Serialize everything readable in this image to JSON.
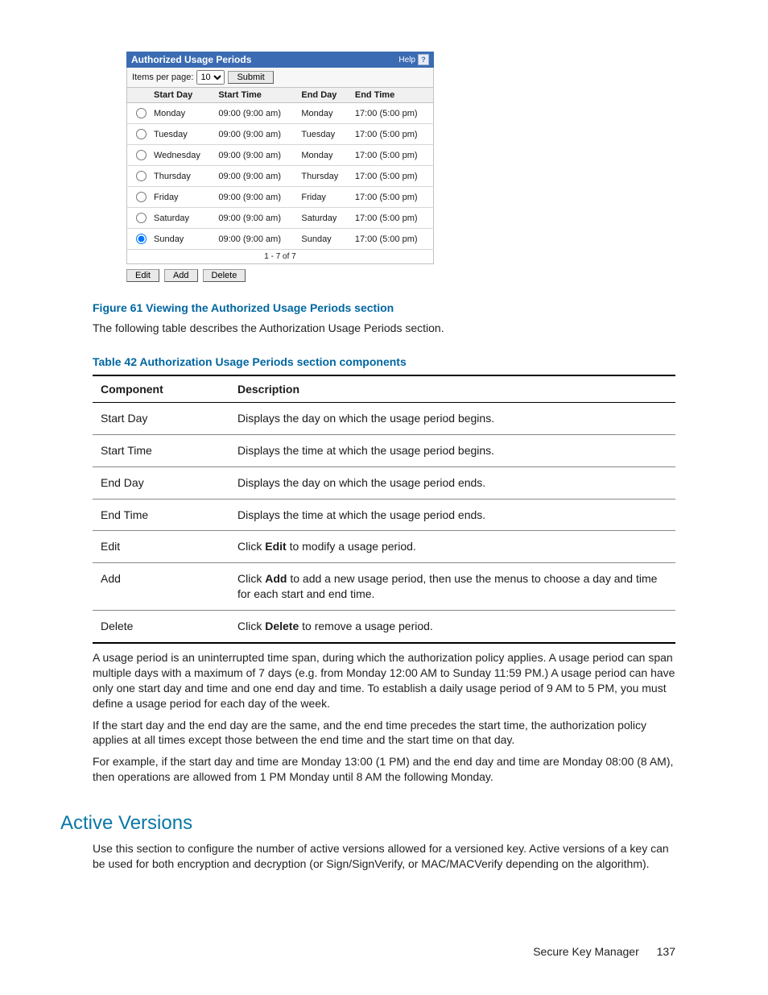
{
  "panel": {
    "title": "Authorized Usage Periods",
    "help_label": "Help",
    "items_per_page_label": "Items per page:",
    "items_per_page_value": "10",
    "submit_label": "Submit",
    "columns": {
      "start_day": "Start Day",
      "start_time": "Start Time",
      "end_day": "End Day",
      "end_time": "End Time"
    },
    "rows": [
      {
        "sel": false,
        "start_day": "Monday",
        "start_time": "09:00 (9:00 am)",
        "end_day": "Monday",
        "end_time": "17:00 (5:00 pm)"
      },
      {
        "sel": false,
        "start_day": "Tuesday",
        "start_time": "09:00 (9:00 am)",
        "end_day": "Tuesday",
        "end_time": "17:00 (5:00 pm)"
      },
      {
        "sel": false,
        "start_day": "Wednesday",
        "start_time": "09:00 (9:00 am)",
        "end_day": "Monday",
        "end_time": "17:00 (5:00 pm)"
      },
      {
        "sel": false,
        "start_day": "Thursday",
        "start_time": "09:00 (9:00 am)",
        "end_day": "Thursday",
        "end_time": "17:00 (5:00 pm)"
      },
      {
        "sel": false,
        "start_day": "Friday",
        "start_time": "09:00 (9:00 am)",
        "end_day": "Friday",
        "end_time": "17:00 (5:00 pm)"
      },
      {
        "sel": false,
        "start_day": "Saturday",
        "start_time": "09:00 (9:00 am)",
        "end_day": "Saturday",
        "end_time": "17:00 (5:00 pm)"
      },
      {
        "sel": true,
        "start_day": "Sunday",
        "start_time": "09:00 (9:00 am)",
        "end_day": "Sunday",
        "end_time": "17:00 (5:00 pm)"
      }
    ],
    "footer_range": "1 - 7 of 7",
    "actions": {
      "edit": "Edit",
      "add": "Add",
      "delete": "Delete"
    }
  },
  "figure_caption": "Figure 61 Viewing the Authorized Usage Periods section",
  "intro_para": "The following table describes the Authorization Usage Periods section.",
  "table_caption": "Table 42 Authorization Usage Periods section components",
  "comp_headers": {
    "component": "Component",
    "description": "Description"
  },
  "comp_rows": [
    {
      "component": "Start Day",
      "desc_pre": "Displays the day on which the usage period begins.",
      "bold": "",
      "desc_post": ""
    },
    {
      "component": "Start Time",
      "desc_pre": "Displays the time at which the usage period begins.",
      "bold": "",
      "desc_post": ""
    },
    {
      "component": "End Day",
      "desc_pre": "Displays the day on which the usage period ends.",
      "bold": "",
      "desc_post": ""
    },
    {
      "component": "End Time",
      "desc_pre": "Displays the time at which the usage period ends.",
      "bold": "",
      "desc_post": ""
    },
    {
      "component": "Edit",
      "desc_pre": "Click ",
      "bold": "Edit",
      "desc_post": " to modify a usage period."
    },
    {
      "component": "Add",
      "desc_pre": "Click ",
      "bold": "Add",
      "desc_post": " to add a new usage period, then use the menus to choose a day and time for each start and end time."
    },
    {
      "component": "Delete",
      "desc_pre": "Click ",
      "bold": "Delete",
      "desc_post": " to remove a usage period."
    }
  ],
  "para1": "A usage period is an uninterrupted time span, during which the authorization policy applies. A usage period can span multiple days with a maximum of 7 days (e.g. from Monday 12:00 AM to Sunday 11:59 PM.) A usage period can have only one start day and time and one end day and time. To establish a daily usage period of 9 AM to 5 PM, you must define a usage period for each day of the week.",
  "para2": "If the start day and the end day are the same, and the end time precedes the start time, the authorization policy applies at all times except those between the end time and the start time on that day.",
  "para3": "For example, if the start day and time are Monday 13:00 (1 PM) and the end day and time are Monday 08:00 (8 AM), then operations are allowed from 1 PM Monday until 8 AM the following Monday.",
  "section_heading": "Active Versions",
  "section_para": "Use this section to configure the number of active versions allowed for a versioned key. Active versions of a key can be used for both encryption and decryption (or Sign/SignVerify, or MAC/MACVerify depending on the algorithm).",
  "footer": {
    "title": "Secure Key Manager",
    "page": "137"
  }
}
